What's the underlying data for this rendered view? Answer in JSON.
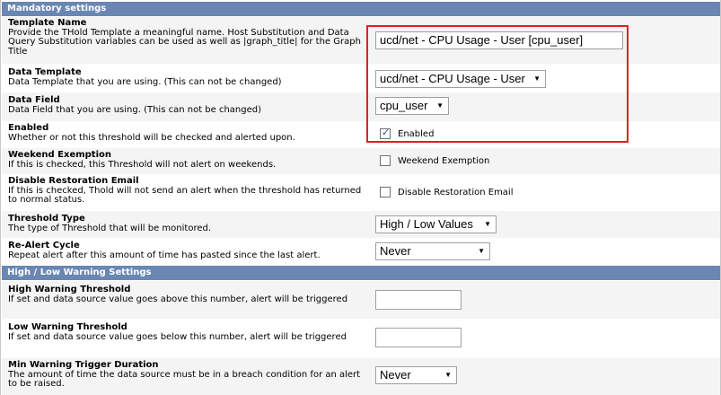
{
  "sections": {
    "mandatory": "Mandatory settings",
    "high_low_warning": "High / Low Warning Settings"
  },
  "fields": {
    "template_name": {
      "title": "Template Name",
      "desc": "Provide the THold Template a meaningful name. Host Substitution and Data Query Substitution variables can be used as well as |graph_title| for the Graph Title",
      "value": "ucd/net - CPU Usage - User [cpu_user]"
    },
    "data_template": {
      "title": "Data Template",
      "desc": "Data Template that you are using. (This can not be changed)",
      "value": "ucd/net - CPU Usage - User"
    },
    "data_field": {
      "title": "Data Field",
      "desc": "Data Field that you are using. (This can not be changed)",
      "value": "cpu_user"
    },
    "enabled": {
      "title": "Enabled",
      "desc": "Whether or not this threshold will be checked and alerted upon.",
      "label": "Enabled",
      "checked": true
    },
    "weekend_exemption": {
      "title": "Weekend Exemption",
      "desc": "If this is checked, this Threshold will not alert on weekends.",
      "label": "Weekend Exemption",
      "checked": false
    },
    "disable_restoration": {
      "title": "Disable Restoration Email",
      "desc": "If this is checked, Thold will not send an alert when the threshold has returned to normal status.",
      "label": "Disable Restoration Email",
      "checked": false
    },
    "threshold_type": {
      "title": "Threshold Type",
      "desc": "The type of Threshold that will be monitored.",
      "value": "High / Low Values"
    },
    "re_alert_cycle": {
      "title": "Re-Alert Cycle",
      "desc": "Repeat alert after this amount of time has pasted since the last alert.",
      "value": "Never"
    },
    "high_warning_threshold": {
      "title": "High Warning Threshold",
      "desc": "If set and data source value goes above this number, alert will be triggered",
      "value": ""
    },
    "low_warning_threshold": {
      "title": "Low Warning Threshold",
      "desc": "If set and data source value goes below this number, alert will be triggered",
      "value": ""
    },
    "min_warning_trigger_duration": {
      "title": "Min Warning Trigger Duration",
      "desc": "The amount of time the data source must be in a breach condition for an alert to be raised.",
      "value": "Never"
    }
  },
  "colors": {
    "section_header": "#6a87b3",
    "highlight_box": "#e02020",
    "row_alt": "#f4f4f4"
  }
}
